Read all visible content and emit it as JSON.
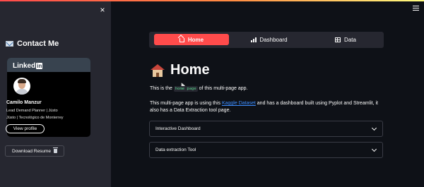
{
  "sidebar": {
    "close_label": "×",
    "contact_title": "Contact Me",
    "card": {
      "brand": "Linked",
      "brand_in": "in",
      "name": "Camilo Manzur",
      "line1": "Lead Demand Planner | Jüsto",
      "line2": "Jüsto | Tecnológico de Monterrey",
      "button": "View profile"
    },
    "download_label": "Download Resume"
  },
  "nav": {
    "items": [
      {
        "label": "Home",
        "icon": "home-icon",
        "active": true
      },
      {
        "label": "Dashboard",
        "icon": "bar-chart-icon",
        "active": false
      },
      {
        "label": "Data",
        "icon": "table-icon",
        "active": false
      }
    ]
  },
  "main": {
    "title": "Home",
    "p1_before": "This is the",
    "p1_code": "home page",
    "p1_after": "of this multi-page app.",
    "p2_before": "This multi-page app is using this",
    "p2_link": "Kaggle Dataset",
    "p2_after": "and has a dashboard built using Pyplot and Streamlit, it also has a Data Extraction tool page.",
    "expanders": [
      {
        "label": "Interactive Dashboard"
      },
      {
        "label": "Data extraction Tool"
      }
    ]
  },
  "colors": {
    "accent": "#ff4b4b",
    "background": "#0e1117",
    "sidebar": "#262730",
    "link": "#3c8dff",
    "code": "#5ad38d"
  }
}
